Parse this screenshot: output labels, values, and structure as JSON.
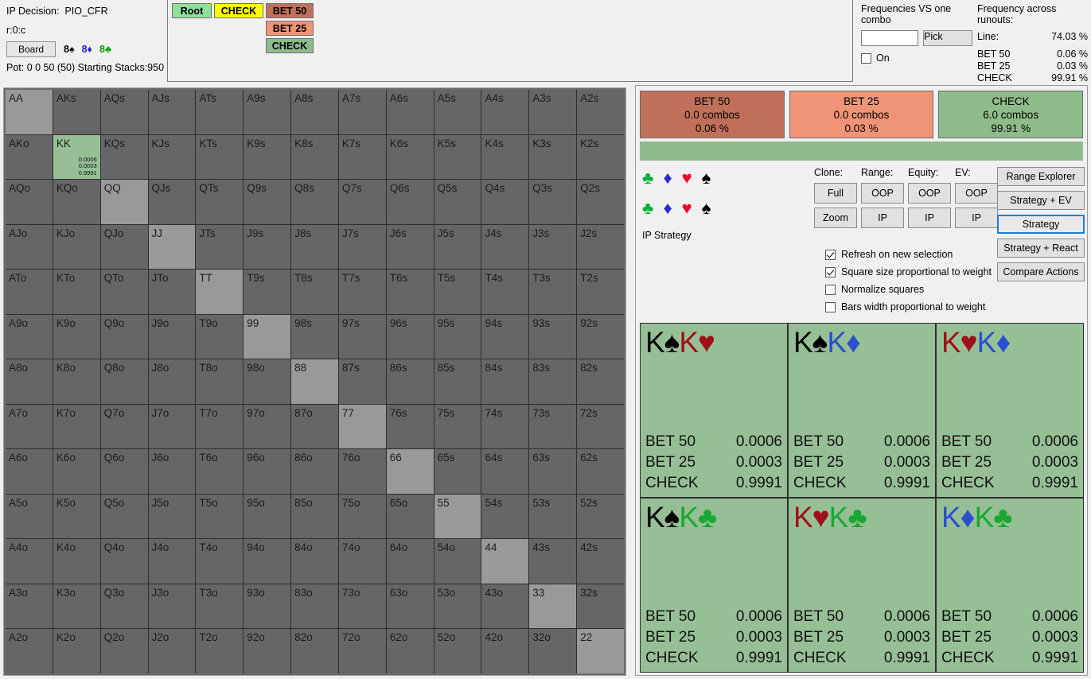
{
  "header": {
    "decision_label": "IP Decision:",
    "decision_value": "PIO_CFR",
    "line_code": "r:0:c",
    "board_button": "Board",
    "board_cards": [
      {
        "rank": "8",
        "suit": "♠",
        "suit_class": "s-s"
      },
      {
        "rank": "8",
        "suit": "♦",
        "suit_class": "s-d"
      },
      {
        "rank": "8",
        "suit": "♣",
        "suit_class": "s-c"
      }
    ],
    "pot_line": "Pot: 0 0 50 (50) Starting Stacks:950"
  },
  "tree": {
    "root": "Root",
    "check_parent": "CHECK",
    "bet50": "BET 50",
    "bet25": "BET 25",
    "check": "CHECK"
  },
  "frequencies": {
    "vs_combo_title": "Frequencies VS one combo",
    "input_value": "",
    "input_placeholder": "",
    "pick_button": "Pick",
    "on_label": "On",
    "runouts_title": "Frequency across runouts:",
    "line_label": "Line:",
    "line_value": "74.03 %",
    "rows": [
      {
        "label": "BET 50",
        "value": "0.06 %"
      },
      {
        "label": "BET 25",
        "value": "0.03 %"
      },
      {
        "label": "CHECK",
        "value": "99.91 %"
      }
    ]
  },
  "actions": [
    {
      "name": "BET 50",
      "combos": "0.0 combos",
      "pct": "0.06 %",
      "color": "#c0705a"
    },
    {
      "name": "BET 25",
      "combos": "0.0 combos",
      "pct": "0.03 %",
      "color": "#ef9476"
    },
    {
      "name": "CHECK",
      "combos": "6.0 combos",
      "pct": "99.91 %",
      "color": "#8ebb8a"
    }
  ],
  "suits": [
    {
      "glyph": "♣",
      "cls": "su-c",
      "name": "club"
    },
    {
      "glyph": "♦",
      "cls": "su-d",
      "name": "diamond"
    },
    {
      "glyph": "♥",
      "cls": "su-h",
      "name": "heart"
    },
    {
      "glyph": "♠",
      "cls": "su-s",
      "name": "spade"
    }
  ],
  "ip_strategy_label": "IP Strategy",
  "controls": {
    "headers": [
      "Clone:",
      "Range:",
      "Equity:",
      "EV:"
    ],
    "row1": [
      "Full",
      "OOP",
      "OOP",
      "OOP"
    ],
    "row2": [
      "Zoom",
      "IP",
      "IP",
      "IP"
    ]
  },
  "options": [
    {
      "label": "Refresh on new selection",
      "checked": true
    },
    {
      "label": "Square size proportional to weight",
      "checked": true
    },
    {
      "label": "Normalize squares",
      "checked": false
    },
    {
      "label": "Bars width proportional to weight",
      "checked": false
    }
  ],
  "side_buttons": [
    {
      "label": "Range Explorer",
      "active": false
    },
    {
      "label": "Strategy + EV",
      "active": false
    },
    {
      "label": "Strategy",
      "active": true
    },
    {
      "label": "Strategy + React",
      "active": false
    },
    {
      "label": "Compare Actions",
      "active": false
    }
  ],
  "matrix": {
    "selected": "KK",
    "selected_values": [
      "0.0006",
      "0.0003",
      "0.9991"
    ],
    "rows": [
      [
        "AA",
        "AKs",
        "AQs",
        "AJs",
        "ATs",
        "A9s",
        "A8s",
        "A7s",
        "A6s",
        "A5s",
        "A4s",
        "A3s",
        "A2s"
      ],
      [
        "AKo",
        "KK",
        "KQs",
        "KJs",
        "KTs",
        "K9s",
        "K8s",
        "K7s",
        "K6s",
        "K5s",
        "K4s",
        "K3s",
        "K2s"
      ],
      [
        "AQo",
        "KQo",
        "QQ",
        "QJs",
        "QTs",
        "Q9s",
        "Q8s",
        "Q7s",
        "Q6s",
        "Q5s",
        "Q4s",
        "Q3s",
        "Q2s"
      ],
      [
        "AJo",
        "KJo",
        "QJo",
        "JJ",
        "JTs",
        "J9s",
        "J8s",
        "J7s",
        "J6s",
        "J5s",
        "J4s",
        "J3s",
        "J2s"
      ],
      [
        "ATo",
        "KTo",
        "QTo",
        "JTo",
        "TT",
        "T9s",
        "T8s",
        "T7s",
        "T6s",
        "T5s",
        "T4s",
        "T3s",
        "T2s"
      ],
      [
        "A9o",
        "K9o",
        "Q9o",
        "J9o",
        "T9o",
        "99",
        "98s",
        "97s",
        "96s",
        "95s",
        "94s",
        "93s",
        "92s"
      ],
      [
        "A8o",
        "K8o",
        "Q8o",
        "J8o",
        "T8o",
        "98o",
        "88",
        "87s",
        "86s",
        "85s",
        "84s",
        "83s",
        "82s"
      ],
      [
        "A7o",
        "K7o",
        "Q7o",
        "J7o",
        "T7o",
        "97o",
        "87o",
        "77",
        "76s",
        "75s",
        "74s",
        "73s",
        "72s"
      ],
      [
        "A6o",
        "K6o",
        "Q6o",
        "J6o",
        "T6o",
        "96o",
        "86o",
        "76o",
        "66",
        "65s",
        "64s",
        "63s",
        "62s"
      ],
      [
        "A5o",
        "K5o",
        "Q5o",
        "J5o",
        "T5o",
        "95o",
        "85o",
        "75o",
        "65o",
        "55",
        "54s",
        "53s",
        "52s"
      ],
      [
        "A4o",
        "K4o",
        "Q4o",
        "J4o",
        "T4o",
        "94o",
        "84o",
        "74o",
        "64o",
        "54o",
        "44",
        "43s",
        "42s"
      ],
      [
        "A3o",
        "K3o",
        "Q3o",
        "J3o",
        "T3o",
        "93o",
        "83o",
        "73o",
        "63o",
        "53o",
        "43o",
        "33",
        "32s"
      ],
      [
        "A2o",
        "K2o",
        "Q2o",
        "J2o",
        "T2o",
        "92o",
        "82o",
        "72o",
        "62o",
        "52o",
        "42o",
        "32o",
        "22"
      ]
    ]
  },
  "combos": [
    {
      "cards": [
        {
          "rank": "K",
          "suit": "♠",
          "cls": "ck-s"
        },
        {
          "rank": "K",
          "suit": "♥",
          "cls": "ck-h"
        }
      ],
      "rows": [
        {
          "label": "BET 50",
          "value": "0.0006"
        },
        {
          "label": "BET 25",
          "value": "0.0003"
        },
        {
          "label": "CHECK",
          "value": "0.9991"
        }
      ],
      "annotated": true
    },
    {
      "cards": [
        {
          "rank": "K",
          "suit": "♠",
          "cls": "ck-s"
        },
        {
          "rank": "K",
          "suit": "♦",
          "cls": "ck-d"
        }
      ],
      "rows": [
        {
          "label": "BET 50",
          "value": "0.0006"
        },
        {
          "label": "BET 25",
          "value": "0.0003"
        },
        {
          "label": "CHECK",
          "value": "0.9991"
        }
      ],
      "annotated": false
    },
    {
      "cards": [
        {
          "rank": "K",
          "suit": "♥",
          "cls": "ck-h"
        },
        {
          "rank": "K",
          "suit": "♦",
          "cls": "ck-d"
        }
      ],
      "rows": [
        {
          "label": "BET 50",
          "value": "0.0006"
        },
        {
          "label": "BET 25",
          "value": "0.0003"
        },
        {
          "label": "CHECK",
          "value": "0.9991"
        }
      ],
      "annotated": false
    },
    {
      "cards": [
        {
          "rank": "K",
          "suit": "♠",
          "cls": "ck-s"
        },
        {
          "rank": "K",
          "suit": "♣",
          "cls": "ck-c"
        }
      ],
      "rows": [
        {
          "label": "BET 50",
          "value": "0.0006"
        },
        {
          "label": "BET 25",
          "value": "0.0003"
        },
        {
          "label": "CHECK",
          "value": "0.9991"
        }
      ],
      "annotated": false
    },
    {
      "cards": [
        {
          "rank": "K",
          "suit": "♥",
          "cls": "ck-h"
        },
        {
          "rank": "K",
          "suit": "♣",
          "cls": "ck-c"
        }
      ],
      "rows": [
        {
          "label": "BET 50",
          "value": "0.0006"
        },
        {
          "label": "BET 25",
          "value": "0.0003"
        },
        {
          "label": "CHECK",
          "value": "0.9991"
        }
      ],
      "annotated": false
    },
    {
      "cards": [
        {
          "rank": "K",
          "suit": "♦",
          "cls": "ck-d"
        },
        {
          "rank": "K",
          "suit": "♣",
          "cls": "ck-c"
        }
      ],
      "rows": [
        {
          "label": "BET 50",
          "value": "0.0006"
        },
        {
          "label": "BET 25",
          "value": "0.0003"
        },
        {
          "label": "CHECK",
          "value": "0.9991"
        }
      ],
      "annotated": false
    }
  ],
  "colors": {
    "bet50": "#c0705a",
    "bet25": "#ef9476",
    "check": "#8ebb8a",
    "selected_cell": "#96bf95",
    "annotation": "#f41818"
  }
}
